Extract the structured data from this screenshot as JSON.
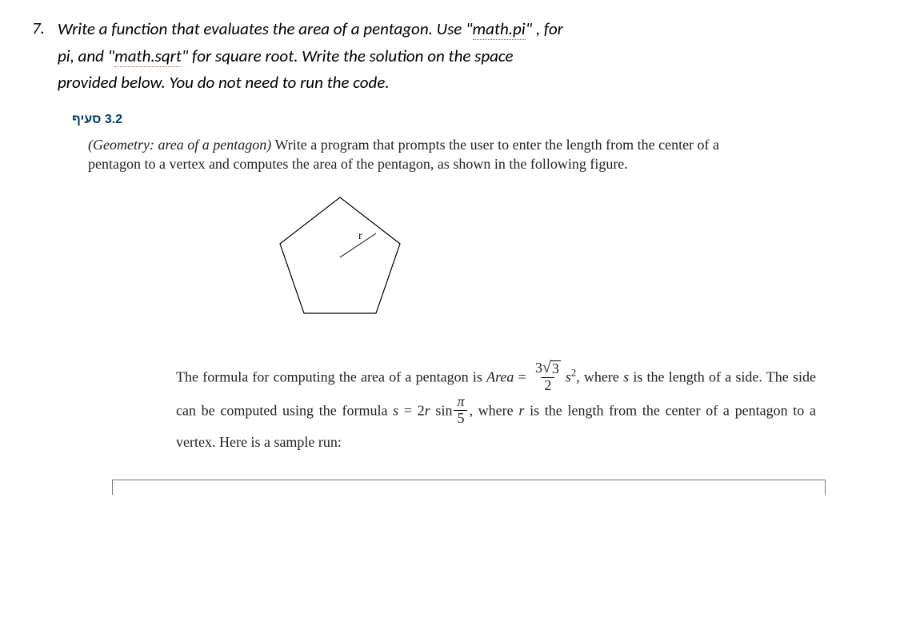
{
  "question": {
    "number": "7.",
    "line1_a": "Write a function that evaluates the area of a pentagon. Use \"",
    "line1_b": "math.pi",
    "line1_c": "\" , for",
    "line2_a": "pi, and  \"",
    "line2_b": "math.sqrt",
    "line2_c": "\"  for square root. Write the solution on the space",
    "line3": "provided below. You do not need to run the code."
  },
  "snippet_label": "3.2 סעיף",
  "exercise": {
    "heading": "(Geometry: area of a pentagon)",
    "text": " Write a program that prompts the user to enter the length from the center of a pentagon to a vertex and computes the area of the pen­tagon, as shown in the following figure."
  },
  "figure": {
    "r_label": "r"
  },
  "formula": {
    "pre": "The formula for computing the area of a pentagon is ",
    "area_var": "Area",
    "eq": " = ",
    "frac1_num_a": "3",
    "frac1_num_rad": "3",
    "frac1_den": "2",
    "s_sq_base": "s",
    "s_sq_exp": "2",
    "mid": ", where ",
    "s_var": "s",
    "mid2": " is the length of a side. The side can be computed using the formula ",
    "s_var2": "s",
    "eq2": " = 2",
    "r_var": "r",
    "sin": " sin",
    "frac2_num": "π",
    "frac2_den": "5",
    "post": ", where ",
    "r_var2": "r",
    "post2": " is the length from the center of a pentagon to a vertex. Here is a sample run:"
  }
}
